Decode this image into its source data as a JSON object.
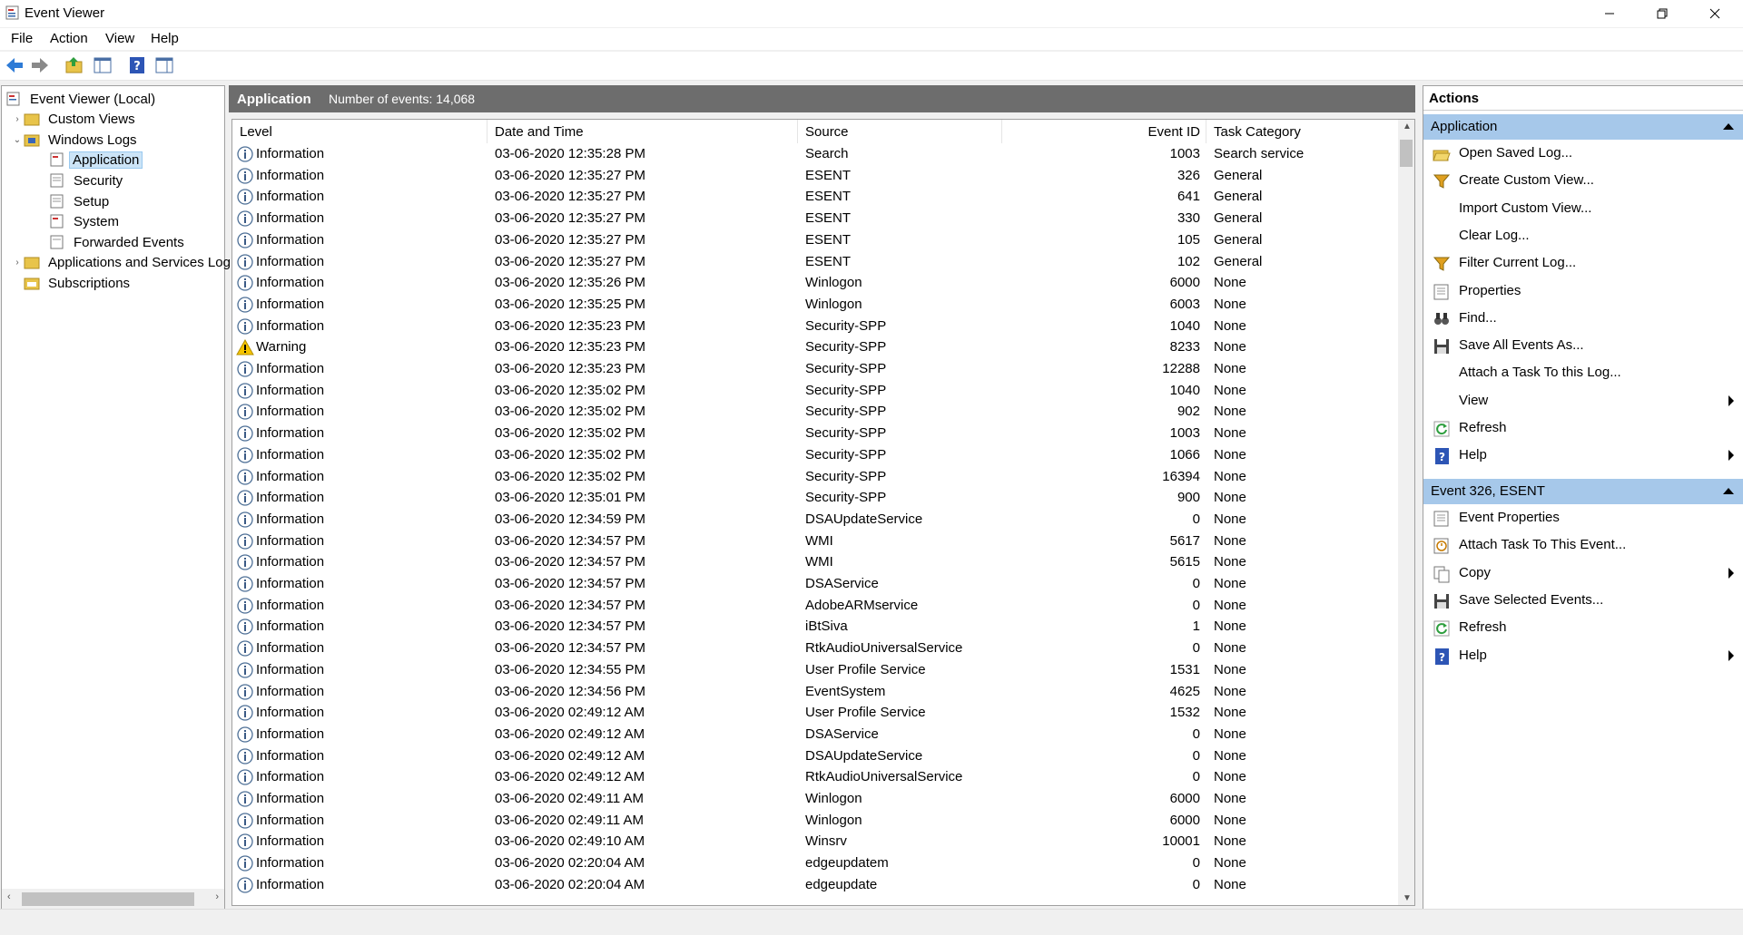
{
  "window": {
    "title": "Event Viewer"
  },
  "menu": [
    "File",
    "Action",
    "View",
    "Help"
  ],
  "tree": {
    "root": "Event Viewer (Local)",
    "custom_views": "Custom Views",
    "windows_logs": "Windows Logs",
    "logs": [
      "Application",
      "Security",
      "Setup",
      "System",
      "Forwarded Events"
    ],
    "apps_services": "Applications and Services Log",
    "subscriptions": "Subscriptions"
  },
  "center": {
    "log_name": "Application",
    "count_text": "Number of events: 14,068",
    "columns": [
      "Level",
      "Date and Time",
      "Source",
      "Event ID",
      "Task Category"
    ],
    "rows": [
      [
        "Information",
        "03-06-2020 12:35:28 PM",
        "Search",
        "1003",
        "Search service"
      ],
      [
        "Information",
        "03-06-2020 12:35:27 PM",
        "ESENT",
        "326",
        "General"
      ],
      [
        "Information",
        "03-06-2020 12:35:27 PM",
        "ESENT",
        "641",
        "General"
      ],
      [
        "Information",
        "03-06-2020 12:35:27 PM",
        "ESENT",
        "330",
        "General"
      ],
      [
        "Information",
        "03-06-2020 12:35:27 PM",
        "ESENT",
        "105",
        "General"
      ],
      [
        "Information",
        "03-06-2020 12:35:27 PM",
        "ESENT",
        "102",
        "General"
      ],
      [
        "Information",
        "03-06-2020 12:35:26 PM",
        "Winlogon",
        "6000",
        "None"
      ],
      [
        "Information",
        "03-06-2020 12:35:25 PM",
        "Winlogon",
        "6003",
        "None"
      ],
      [
        "Information",
        "03-06-2020 12:35:23 PM",
        "Security-SPP",
        "1040",
        "None"
      ],
      [
        "Warning",
        "03-06-2020 12:35:23 PM",
        "Security-SPP",
        "8233",
        "None"
      ],
      [
        "Information",
        "03-06-2020 12:35:23 PM",
        "Security-SPP",
        "12288",
        "None"
      ],
      [
        "Information",
        "03-06-2020 12:35:02 PM",
        "Security-SPP",
        "1040",
        "None"
      ],
      [
        "Information",
        "03-06-2020 12:35:02 PM",
        "Security-SPP",
        "902",
        "None"
      ],
      [
        "Information",
        "03-06-2020 12:35:02 PM",
        "Security-SPP",
        "1003",
        "None"
      ],
      [
        "Information",
        "03-06-2020 12:35:02 PM",
        "Security-SPP",
        "1066",
        "None"
      ],
      [
        "Information",
        "03-06-2020 12:35:02 PM",
        "Security-SPP",
        "16394",
        "None"
      ],
      [
        "Information",
        "03-06-2020 12:35:01 PM",
        "Security-SPP",
        "900",
        "None"
      ],
      [
        "Information",
        "03-06-2020 12:34:59 PM",
        "DSAUpdateService",
        "0",
        "None"
      ],
      [
        "Information",
        "03-06-2020 12:34:57 PM",
        "WMI",
        "5617",
        "None"
      ],
      [
        "Information",
        "03-06-2020 12:34:57 PM",
        "WMI",
        "5615",
        "None"
      ],
      [
        "Information",
        "03-06-2020 12:34:57 PM",
        "DSAService",
        "0",
        "None"
      ],
      [
        "Information",
        "03-06-2020 12:34:57 PM",
        "AdobeARMservice",
        "0",
        "None"
      ],
      [
        "Information",
        "03-06-2020 12:34:57 PM",
        "iBtSiva",
        "1",
        "None"
      ],
      [
        "Information",
        "03-06-2020 12:34:57 PM",
        "RtkAudioUniversalService",
        "0",
        "None"
      ],
      [
        "Information",
        "03-06-2020 12:34:55 PM",
        "User Profile Service",
        "1531",
        "None"
      ],
      [
        "Information",
        "03-06-2020 12:34:56 PM",
        "EventSystem",
        "4625",
        "None"
      ],
      [
        "Information",
        "03-06-2020 02:49:12 AM",
        "User Profile Service",
        "1532",
        "None"
      ],
      [
        "Information",
        "03-06-2020 02:49:12 AM",
        "DSAService",
        "0",
        "None"
      ],
      [
        "Information",
        "03-06-2020 02:49:12 AM",
        "DSAUpdateService",
        "0",
        "None"
      ],
      [
        "Information",
        "03-06-2020 02:49:12 AM",
        "RtkAudioUniversalService",
        "0",
        "None"
      ],
      [
        "Information",
        "03-06-2020 02:49:11 AM",
        "Winlogon",
        "6000",
        "None"
      ],
      [
        "Information",
        "03-06-2020 02:49:11 AM",
        "Winlogon",
        "6000",
        "None"
      ],
      [
        "Information",
        "03-06-2020 02:49:10 AM",
        "Winsrv",
        "10001",
        "None"
      ],
      [
        "Information",
        "03-06-2020 02:20:04 AM",
        "edgeupdatem",
        "0",
        "None"
      ],
      [
        "Information",
        "03-06-2020 02:20:04 AM",
        "edgeupdate",
        "0",
        "None"
      ]
    ]
  },
  "actions": {
    "title": "Actions",
    "section1": "Application",
    "items1": [
      {
        "label": "Open Saved Log...",
        "icon": "folder-open-icon",
        "sub": false
      },
      {
        "label": "Create Custom View...",
        "icon": "filter-icon",
        "sub": false
      },
      {
        "label": "Import Custom View...",
        "icon": "",
        "sub": false
      },
      {
        "label": "Clear Log...",
        "icon": "",
        "sub": false
      },
      {
        "label": "Filter Current Log...",
        "icon": "filter-icon",
        "sub": false
      },
      {
        "label": "Properties",
        "icon": "properties-icon",
        "sub": false
      },
      {
        "label": "Find...",
        "icon": "binoculars-icon",
        "sub": false
      },
      {
        "label": "Save All Events As...",
        "icon": "save-icon",
        "sub": false
      },
      {
        "label": "Attach a Task To this Log...",
        "icon": "",
        "sub": false
      },
      {
        "label": "View",
        "icon": "",
        "sub": true
      },
      {
        "label": "Refresh",
        "icon": "refresh-icon",
        "sub": false
      },
      {
        "label": "Help",
        "icon": "help-icon",
        "sub": true
      }
    ],
    "section2": "Event 326, ESENT",
    "items2": [
      {
        "label": "Event Properties",
        "icon": "properties-icon",
        "sub": false
      },
      {
        "label": "Attach Task To This Event...",
        "icon": "task-icon",
        "sub": false
      },
      {
        "label": "Copy",
        "icon": "copy-icon",
        "sub": true
      },
      {
        "label": "Save Selected Events...",
        "icon": "save-icon",
        "sub": false
      },
      {
        "label": "Refresh",
        "icon": "refresh-icon",
        "sub": false
      },
      {
        "label": "Help",
        "icon": "help-icon",
        "sub": true
      }
    ]
  },
  "colors": {
    "accent_section": "#a6c8ea",
    "selected": "#cce4f7",
    "header_gray": "#6d6d6d"
  }
}
